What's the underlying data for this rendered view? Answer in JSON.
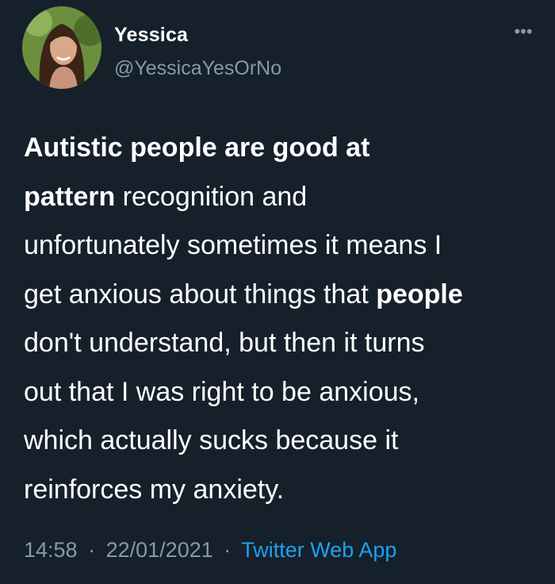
{
  "user": {
    "name": "Yessica",
    "handle": "@YessicaYesOrNo"
  },
  "tweet": {
    "lines": [
      [
        {
          "text": "Autistic people are good at",
          "bold": true
        }
      ],
      [
        {
          "text": "pattern",
          "bold": true
        },
        {
          "text": " recognition and",
          "bold": false
        }
      ],
      [
        {
          "text": "unfortunately sometimes it means I",
          "bold": false
        }
      ],
      [
        {
          "text": "get anxious about things that ",
          "bold": false
        },
        {
          "text": "people",
          "bold": true
        }
      ],
      [
        {
          "text": "don't understand, but then it turns",
          "bold": false
        }
      ],
      [
        {
          "text": "out that I was right to be anxious,",
          "bold": false
        }
      ],
      [
        {
          "text": "which actually sucks because it",
          "bold": false
        }
      ],
      [
        {
          "text": "reinforces my anxiety.",
          "bold": false
        }
      ]
    ]
  },
  "meta": {
    "time": "14:58",
    "date": "22/01/2021",
    "separator": "·",
    "source": "Twitter Web App"
  },
  "icons": {
    "more": "more-options-icon"
  },
  "colors": {
    "background": "#15202b",
    "secondary_text": "#8899a6",
    "link": "#1da1f2"
  }
}
